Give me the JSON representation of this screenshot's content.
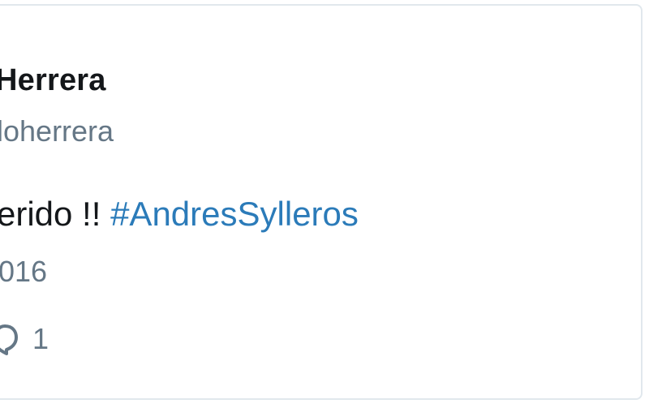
{
  "tweet": {
    "name": "Herrera",
    "handle": "loherrera",
    "text": "erido !! ",
    "hashtag": "#AndresSylleros",
    "date": "016",
    "reply_count": "1",
    "reply_icon": "reply-icon",
    "colors": {
      "text": "#14171a",
      "secondary": "#657786",
      "link": "#2b7bb9",
      "border": "#e1e8ed"
    }
  }
}
